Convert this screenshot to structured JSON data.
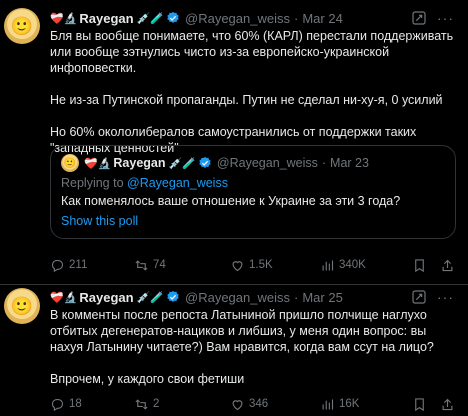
{
  "tweets": [
    {
      "emojis": "❤️‍🩹🔬",
      "name": "Rayegan",
      "name_emojis": "💉🧪",
      "handle": "@Rayegan_weiss",
      "dot": "·",
      "time": "Mar 24",
      "body": [
        "Бля вы вообще понимаете, что 60% (КАРЛ) перестали поддерживать или вообще зэтнулись чисто из-за европейско-украинской инфоповестки.",
        "Не из-за Путинской пропаганды. Путин не сделал ни-ху-я, 0 усилий",
        "Но 60% около­либералов самоустранились от поддержки таких \"западных ценностей\""
      ],
      "quote": {
        "name": "Rayegan",
        "name_emojis": "💉🧪",
        "handle": "@Rayegan_weiss",
        "time": "Mar 23",
        "replying_prefix": "Replying to ",
        "replying_handle": "@Rayegan_weiss",
        "text": "Как поменялось ваше отношение к Украине за эти 3 года?",
        "poll_link": "Show this poll"
      },
      "actions": {
        "replies": "211",
        "reposts": "74",
        "likes": "1.5K",
        "views": "340K"
      }
    },
    {
      "emojis": "❤️‍🩹🔬",
      "name": "Rayegan",
      "name_emojis": "💉🧪",
      "handle": "@Rayegan_weiss",
      "dot": "·",
      "time": "Mar 25",
      "body": [
        "В комменты после репоста Латыниной пришло полчище наглухо отбитых дегенератов-нациков и либшиз, у меня один вопрос: вы нахуя Латынину читаете?) Вам нравится, когда вам ссут на лицо?",
        "Впрочем, у каждого свои фетиши"
      ],
      "actions": {
        "replies": "18",
        "reposts": "2",
        "likes": "346",
        "views": "16K"
      }
    }
  ],
  "colors": {
    "background": "#000000",
    "text": "#e7e9ea",
    "muted": "#71767b",
    "link": "#1d9bf0",
    "border": "#2f3336",
    "verified": "#1d9bf0"
  }
}
